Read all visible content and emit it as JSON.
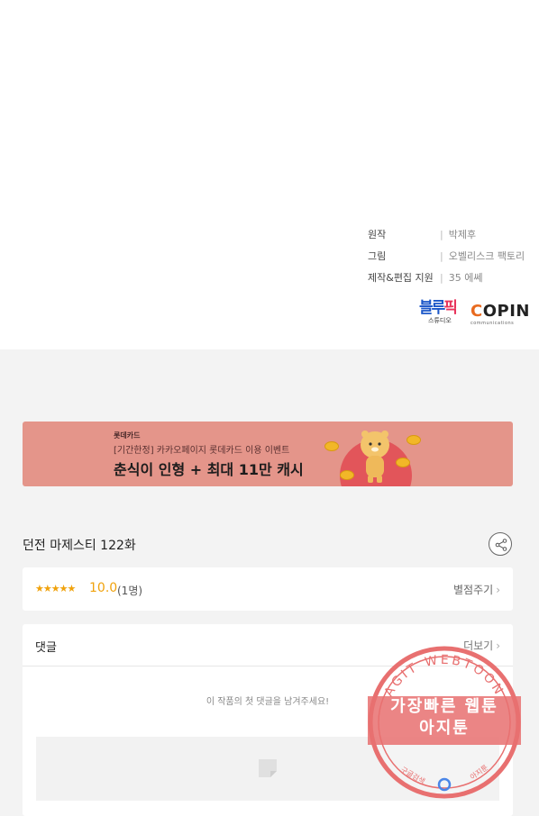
{
  "credits": [
    {
      "role": "원작",
      "name": "박제후"
    },
    {
      "role": "그림",
      "name": "오벨리스크 팩토리"
    },
    {
      "role": "제작&편집 지원",
      "name": "35 에쎄"
    }
  ],
  "logos": {
    "blue_main": "블루픽",
    "blue_sub": "스튜디오",
    "copin_main": "COPIN",
    "copin_sub": "communications"
  },
  "banner": {
    "brand": "롯데카드",
    "subtitle": "[기간한정] 카카오페이지 롯데카드 이용 이벤트",
    "headline": "춘식이 인형 + 최대 11만 캐시",
    "colors": {
      "background": "#e4958a",
      "circle": "#e2555a",
      "coin": "#f2b728"
    }
  },
  "episode": {
    "title": "던전 마제스티 122화",
    "share_icon": "share-icon"
  },
  "rating": {
    "stars": "★★★★★",
    "score": "10.0",
    "count": "(1명)",
    "rate_link": "별점주기",
    "color": "#f0a20c"
  },
  "comments": {
    "title": "댓글",
    "more": "더보기",
    "empty_message": "이 작품의 첫 댓글을 남겨주세요!",
    "input_icon": "comment-placeholder-icon"
  },
  "watermark": {
    "ring_text": "AGIT WEBTOON",
    "line1": "가장빠른 웹툰",
    "line2": "아지툰",
    "ring_bottom_left": "구글검색",
    "ring_bottom_right": "아지툰",
    "color": "#e87070"
  },
  "chevron": "›"
}
